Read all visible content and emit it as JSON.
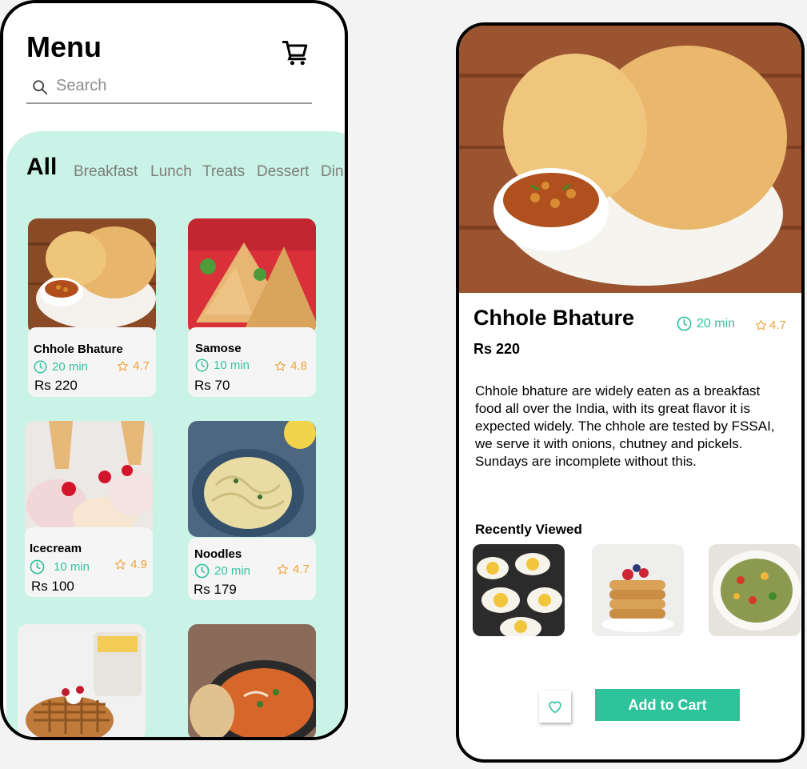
{
  "menu_screen": {
    "title": "Menu",
    "search": {
      "placeholder": "Search"
    },
    "categories": {
      "active": "All",
      "items": [
        "Breakfast",
        "Lunch",
        "Treats",
        "Dessert",
        "Din"
      ]
    },
    "items": [
      {
        "name": "Chhole Bhature",
        "time": "20 min",
        "rating": "4.7",
        "price": "Rs 220"
      },
      {
        "name": "Samose",
        "time": "10 min",
        "rating": "4.8",
        "price": "Rs 70"
      },
      {
        "name": "Icecream",
        "time": "10 min",
        "rating": "4.9",
        "price": "Rs 100"
      },
      {
        "name": "Noodles",
        "time": "20 min",
        "rating": "4.7",
        "price": "Rs 179"
      }
    ]
  },
  "detail_screen": {
    "name": "Chhole Bhature",
    "time": "20 min",
    "rating": "4.7",
    "price": "Rs 220",
    "description": "Chhole bhature are widely eaten as a breakfast food all over the India, with its great flavor it is expected widely. The chhole are tested by FSSAI, we serve it with onions, chutney and pickels. Sundays are incomplete without this.",
    "recently_viewed_title": "Recently Viewed",
    "add_to_cart_label": "Add to Cart"
  },
  "colors": {
    "teal": "#c9f3e6",
    "accent": "#2ec39a",
    "rating": "#f0a23a"
  },
  "icons": [
    "cart-icon",
    "search-icon",
    "clock-icon",
    "star-icon",
    "heart-icon"
  ]
}
